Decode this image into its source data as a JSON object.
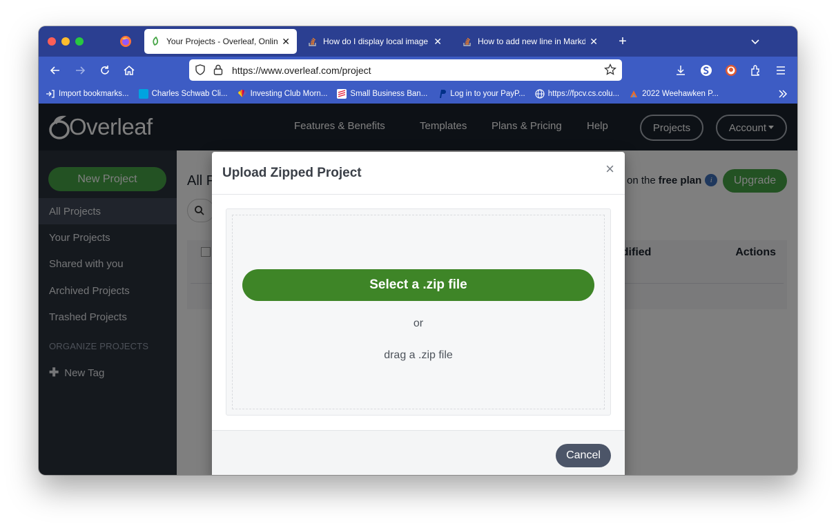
{
  "browser": {
    "tabs": [
      {
        "title": "Your Projects - Overleaf, Online",
        "icon": "overleaf-leaf-icon",
        "active": true
      },
      {
        "title": "How do I display local image in",
        "icon": "stackoverflow-icon",
        "active": false
      },
      {
        "title": "How to add new line in Markdow",
        "icon": "stackoverflow-icon",
        "active": false
      }
    ],
    "url": "https://www.overleaf.com/project",
    "bookmarks": [
      {
        "label": "Import bookmarks...",
        "icon": "import-icon",
        "color": "#ffffff"
      },
      {
        "label": "Charles Schwab Cli...",
        "icon": "schwab-icon",
        "color": "#00a3e0"
      },
      {
        "label": "Investing Club Morn...",
        "icon": "cnbc-icon",
        "color": "#ffb000"
      },
      {
        "label": "Small Business Ban...",
        "icon": "bofa-icon",
        "color": "#e31837"
      },
      {
        "label": "Log in to your PayP...",
        "icon": "paypal-icon",
        "color": "#003087"
      },
      {
        "label": "https://fpcv.cs.colu...",
        "icon": "globe-icon",
        "color": "#ffffff"
      },
      {
        "label": "2022 Weehawken P...",
        "icon": "weehawken-icon",
        "color": "#e96b2b"
      }
    ]
  },
  "overleaf": {
    "logo_text": "Overleaf",
    "nav": {
      "features": "Features & Benefits",
      "templates": "Templates",
      "plans": "Plans & Pricing",
      "help": "Help",
      "projects": "Projects",
      "account": "Account"
    },
    "sidebar": {
      "new_project": "New Project",
      "items": [
        {
          "label": "All Projects",
          "active": true
        },
        {
          "label": "Your Projects",
          "active": false
        },
        {
          "label": "Shared with you",
          "active": false
        },
        {
          "label": "Archived Projects",
          "active": false
        },
        {
          "label": "Trashed Projects",
          "active": false
        }
      ],
      "organize_heading": "ORGANIZE PROJECTS",
      "new_tag": "New Tag"
    },
    "main": {
      "title": "All P",
      "plan_prefix": "on the",
      "plan_name": "free plan",
      "upgrade": "Upgrade",
      "table_modified_header": "odified",
      "table_actions_header": "Actions"
    }
  },
  "modal": {
    "title": "Upload Zipped Project",
    "close": "×",
    "select_button": "Select a .zip file",
    "or_text": "or",
    "drag_text": "drag a .zip file",
    "cancel_button": "Cancel"
  },
  "colors": {
    "tabstrip": "#2b3f91",
    "navbar": "#3d5cc4",
    "overleaf_green": "#46a546",
    "modal_green": "#3e8527",
    "cancel_button": "#4c5568"
  }
}
